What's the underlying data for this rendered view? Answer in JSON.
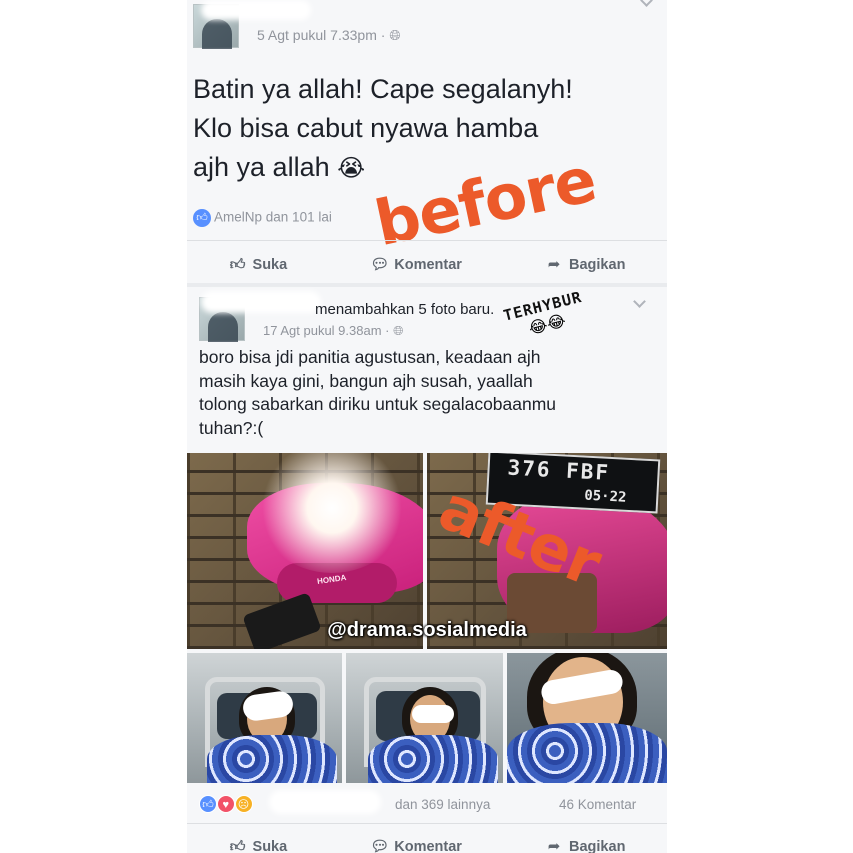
{
  "post1": {
    "timestamp": "5 Agt pukul 7.33pm",
    "privacy_icon": "globe-icon",
    "text_lines": [
      "Batin ya allah!  Cape segalanyh!",
      "Klo bisa cabut nyawa hamba",
      "ajh ya allah"
    ],
    "emoji": "😭",
    "reactions": "AmelNp dan 101 lai",
    "stamp": "before",
    "actions": {
      "like": "Suka",
      "comment": "Komentar",
      "share": "Bagikan"
    }
  },
  "post2": {
    "header_action": "menambahkan 5 foto baru.",
    "timestamp": "17 Agt pukul 9.38am",
    "privacy_icon": "globe-icon",
    "sticker_text": "TERHYBUR",
    "sticker_emoji": "😂😂",
    "text_lines": [
      "boro bisa jdi panitia agustusan, keadaan ajh",
      "masih kaya gini, bangun ajh susah, yaallah",
      "tolong sabarkan diriku untuk segalacobaanmu",
      "tuhan?:("
    ],
    "plate_top": "376 FBF",
    "plate_bottom": "05·22",
    "bike_brand": "HONDA",
    "stamp": "after",
    "watermark": "@drama.sosialmedia",
    "reactions_text": "dan 369 lainnya",
    "comments_count": "46 Komentar",
    "actions": {
      "like": "Suka",
      "comment": "Komentar",
      "share": "Bagikan"
    }
  },
  "colors": {
    "accent": "#5890ff",
    "stamp": "#ec5a2a",
    "text": "#1d2129",
    "meta": "#90949c"
  }
}
